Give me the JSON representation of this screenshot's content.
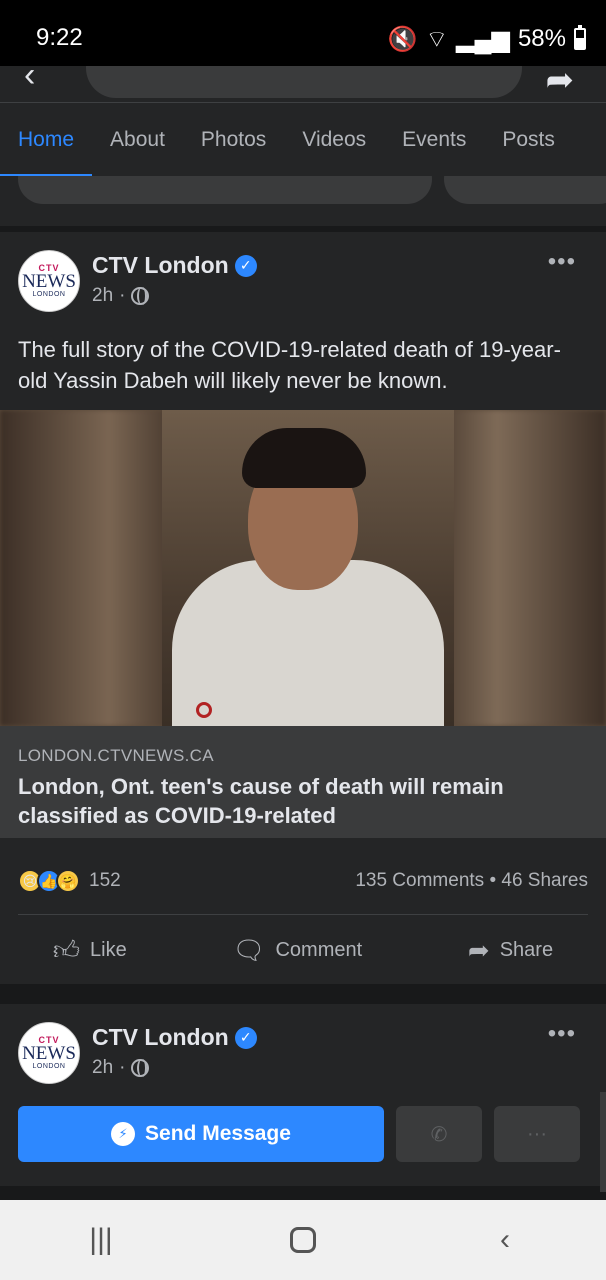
{
  "status_bar": {
    "time": "9:22",
    "battery": "58%"
  },
  "tabs": [
    {
      "label": "Home"
    },
    {
      "label": "About"
    },
    {
      "label": "Photos"
    },
    {
      "label": "Videos"
    },
    {
      "label": "Events"
    },
    {
      "label": "Posts"
    }
  ],
  "post": {
    "page_name": "CTV London",
    "avatar": {
      "ctv": "CTV",
      "news": "NEWS",
      "city": "LONDON"
    },
    "time": "2h",
    "text": "The full story of the COVID-19-related death of 19-year-old Yassin Dabeh will likely never be known.",
    "link": {
      "domain": "LONDON.CTVNEWS.CA",
      "title": "London, Ont. teen's cause of death will remain classified as COVID-19-related"
    },
    "reaction_count": "152",
    "comments_shares": "135 Comments • 46 Shares",
    "actions": {
      "like": "Like",
      "comment": "Comment",
      "share": "Share"
    }
  },
  "post2": {
    "page_name": "CTV London",
    "avatar": {
      "ctv": "CTV",
      "news": "NEWS",
      "city": "LONDON"
    },
    "time": "2h",
    "send_message": "Send Message"
  },
  "colors": {
    "accent": "#2d88ff",
    "card": "#242526",
    "background": "#18191a"
  }
}
